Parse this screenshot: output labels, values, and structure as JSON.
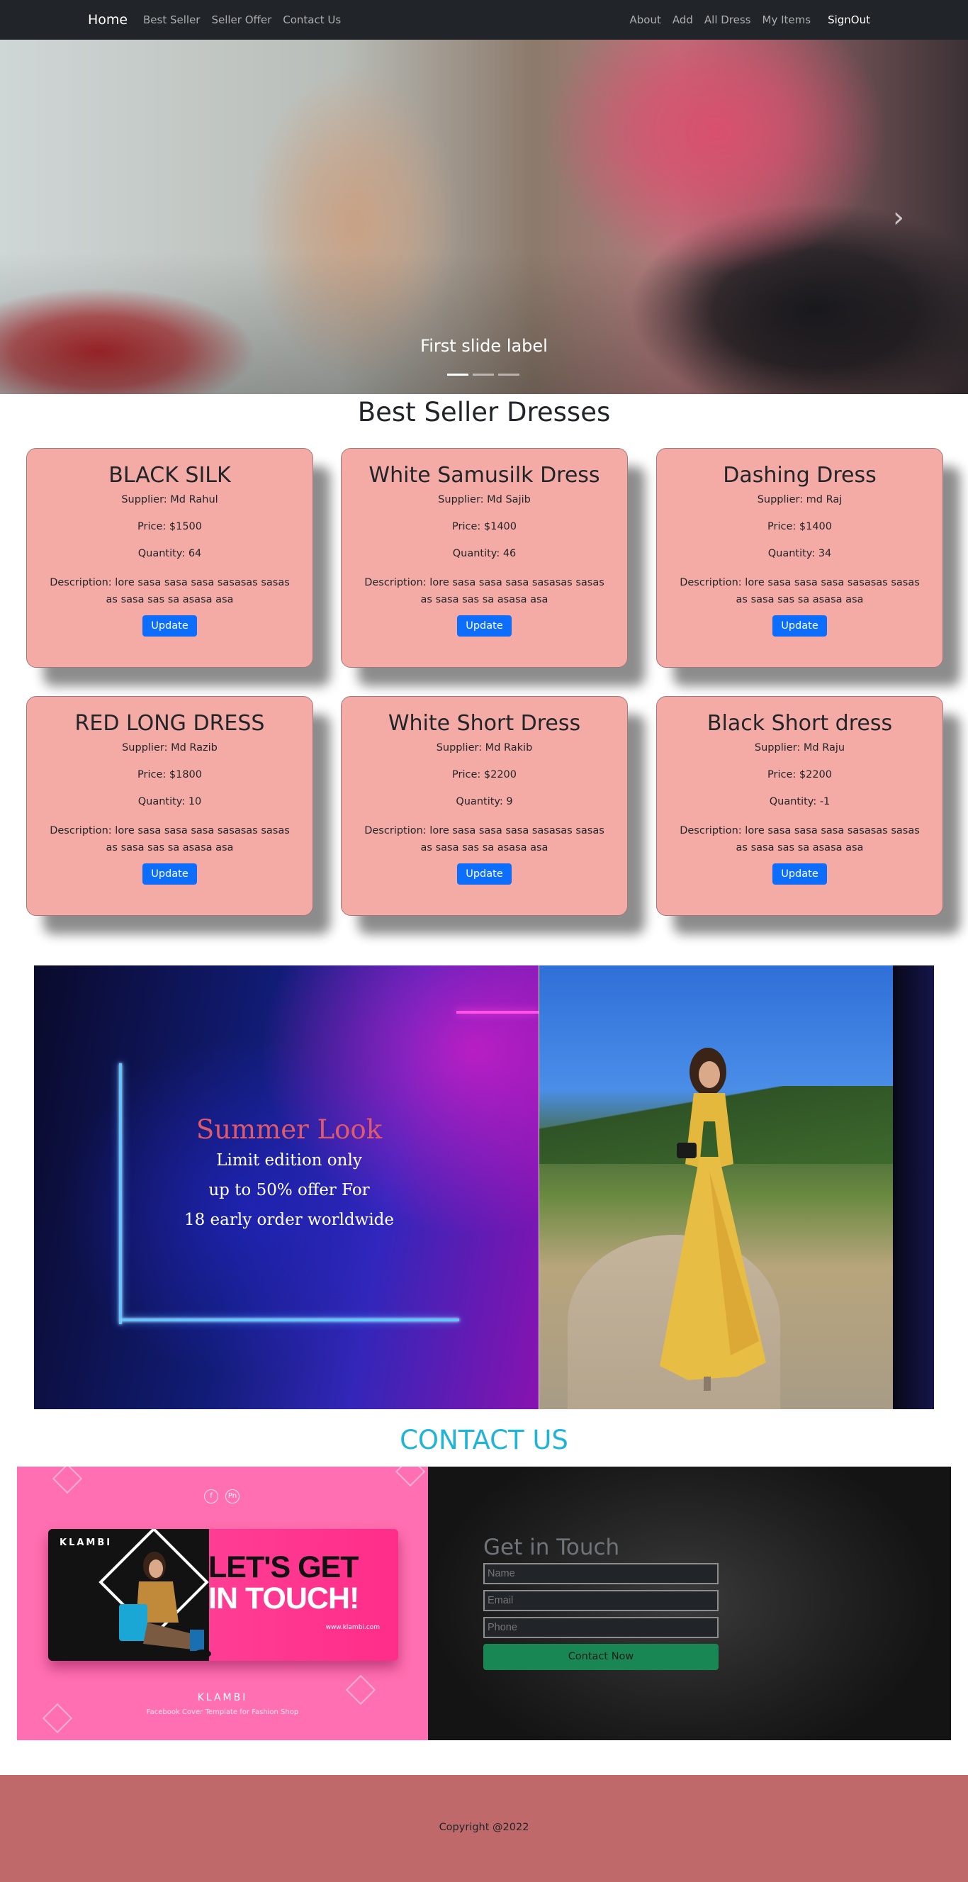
{
  "navbar": {
    "brand": "Home",
    "left_links": [
      "Best Seller",
      "Seller Offer",
      "Contact Us"
    ],
    "right_links": [
      "About",
      "Add",
      "All Dress",
      "My Items"
    ],
    "signout": "SignOut"
  },
  "hero": {
    "caption": "First slide label",
    "next_icon": "chevron-right-icon",
    "slides": 3,
    "active_slide": 1
  },
  "best_seller": {
    "title": "Best Seller Dresses",
    "cards": [
      {
        "name": "BLACK SILK",
        "supplier": "Supplier: Md Rahul",
        "price": "Price: $1500",
        "quantity": "Quantity: 64",
        "description": "Description: lore sasa sasa sasa sasasas sasas as sasa sas sa asasa asa",
        "button": "Update"
      },
      {
        "name": "White Samusilk Dress",
        "supplier": "Supplier: Md Sajib",
        "price": "Price: $1400",
        "quantity": "Quantity: 46",
        "description": "Description: lore sasa sasa sasa sasasas sasas as sasa sas sa asasa asa",
        "button": "Update"
      },
      {
        "name": "Dashing Dress",
        "supplier": "Supplier: md Raj",
        "price": "Price: $1400",
        "quantity": "Quantity: 34",
        "description": "Description: lore sasa sasa sasa sasasas sasas as sasa sas sa asasa asa",
        "button": "Update"
      },
      {
        "name": "RED LONG DRESS",
        "supplier": "Supplier: Md Razib",
        "price": "Price: $1800",
        "quantity": "Quantity: 10",
        "description": "Description: lore sasa sasa sasa sasasas sasas as sasa sas sa asasa asa",
        "button": "Update"
      },
      {
        "name": "White Short Dress",
        "supplier": "Supplier: Md Rakib",
        "price": "Price: $2200",
        "quantity": "Quantity: 9",
        "description": "Description: lore sasa sasa sasa sasasas sasas as sasa sas sa asasa asa",
        "button": "Update"
      },
      {
        "name": "Black Short dress",
        "supplier": "Supplier: Md Raju",
        "price": "Price: $2200",
        "quantity": "Quantity: -1",
        "description": "Description: lore sasa sasa sasa sasasas sasas as sasa sas sa asasa asa",
        "button": "Update"
      }
    ]
  },
  "promo": {
    "headline": "Summer Look",
    "lines": [
      "Limit edition only",
      "up to 50% offer For",
      "18 early order worldwide"
    ]
  },
  "contact": {
    "title": "CONTACT US",
    "banner": {
      "brand": "KLAMBI",
      "headline_line1": "LET'S GET",
      "headline_line2": "IN TOUCH!",
      "url": "www.klambi.com",
      "footer_brand": "KLAMBI",
      "footer_sub": "Facebook Cover Template for Fashion Shop",
      "social_icons": [
        "f",
        "Pn"
      ]
    },
    "form": {
      "title": "Get in Touch",
      "name_placeholder": "Name",
      "email_placeholder": "Email",
      "phone_placeholder": "Phone",
      "submit": "Contact Now"
    }
  },
  "footer": {
    "copyright": "Copyright @2022"
  },
  "colors": {
    "navbar_bg": "#212529",
    "card_bg": "#f4aba6",
    "button_blue": "#0d6efd",
    "contact_title": "#21b4d9",
    "contact_button": "#198754",
    "footer_bg": "#c0696a",
    "banner_pink": "#ff6fb1"
  }
}
